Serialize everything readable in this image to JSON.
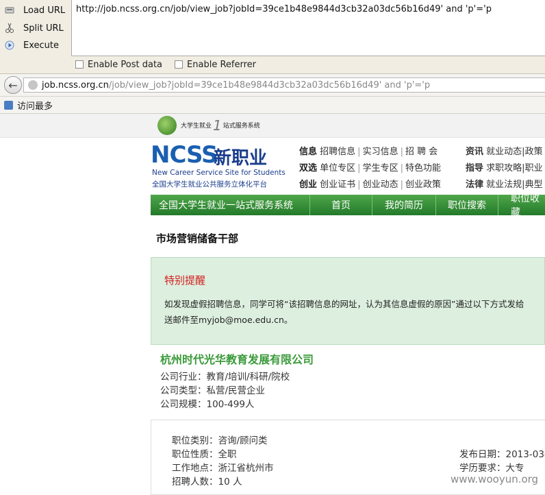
{
  "hackbar": {
    "load_label": "Load URL",
    "split_label": "Split URL",
    "execute_label": "Execute",
    "url_value": "http://job.ncss.org.cn/job/view_job?jobId=39ce1b48e9844d3cb32a03dc56b16d49' and 'p'='p",
    "enable_post": "Enable Post data",
    "enable_referrer": "Enable Referrer"
  },
  "browser": {
    "address_host": "job.ncss.org.cn",
    "address_path": "/job/view_job?jobId=39ce1b48e9844d3cb32a03dc56b16d49' and 'p'='p",
    "bookmark": "访问最多"
  },
  "site": {
    "sublogo_text1": "大学生就业",
    "sublogo_num": "1",
    "sublogo_text2": "站式服务系统",
    "logo_ncs": "NCSS",
    "logo_cn": "新职业",
    "logo_en": "New Career Service Site for Students",
    "logo_sub": "全国大学生就业公共服务立体化平台",
    "nav_rows": [
      {
        "head": "信息",
        "items": [
          "招聘信息",
          "实习信息",
          "招 聘 会"
        ]
      },
      {
        "head": "双选",
        "items": [
          "单位专区",
          "学生专区",
          "特色功能"
        ]
      },
      {
        "head": "创业",
        "items": [
          "创业证书",
          "创业动态",
          "创业政策"
        ]
      }
    ],
    "nav_rows_right": [
      {
        "head": "资讯",
        "items": [
          "就业动态",
          "政策"
        ]
      },
      {
        "head": "指导",
        "items": [
          "求职攻略",
          "职业"
        ]
      },
      {
        "head": "法律",
        "items": [
          "就业法规",
          "典型"
        ]
      }
    ],
    "greenbar_title": "全国大学生就业一站式服务系统",
    "tabs": [
      "首页",
      "我的简历",
      "职位搜索",
      "职位收藏"
    ]
  },
  "job": {
    "title": "市场营销储备干部",
    "notice_heading": "特别提醒",
    "notice_line1": "如发现虚假招聘信息，同学可将“该招聘信息的网址，认为其信息虚假的原因”通过以下方式发给",
    "notice_line2": "送邮件至myjob@moe.edu.cn。",
    "company": "杭州时代光华教育发展有限公司",
    "company_info": [
      "公司行业：教育/培训/科研/院校",
      "公司类型：私营/民营企业",
      "公司规模：100-499人"
    ],
    "job_info": [
      "职位类别：咨询/顾问类",
      "职位性质：全职",
      "工作地点：浙江省杭州市",
      "招聘人数：10 人"
    ],
    "job_right": [
      "发布日期：2013-03-",
      "学历要求：大专"
    ]
  },
  "watermark": "www.wooyun.org"
}
